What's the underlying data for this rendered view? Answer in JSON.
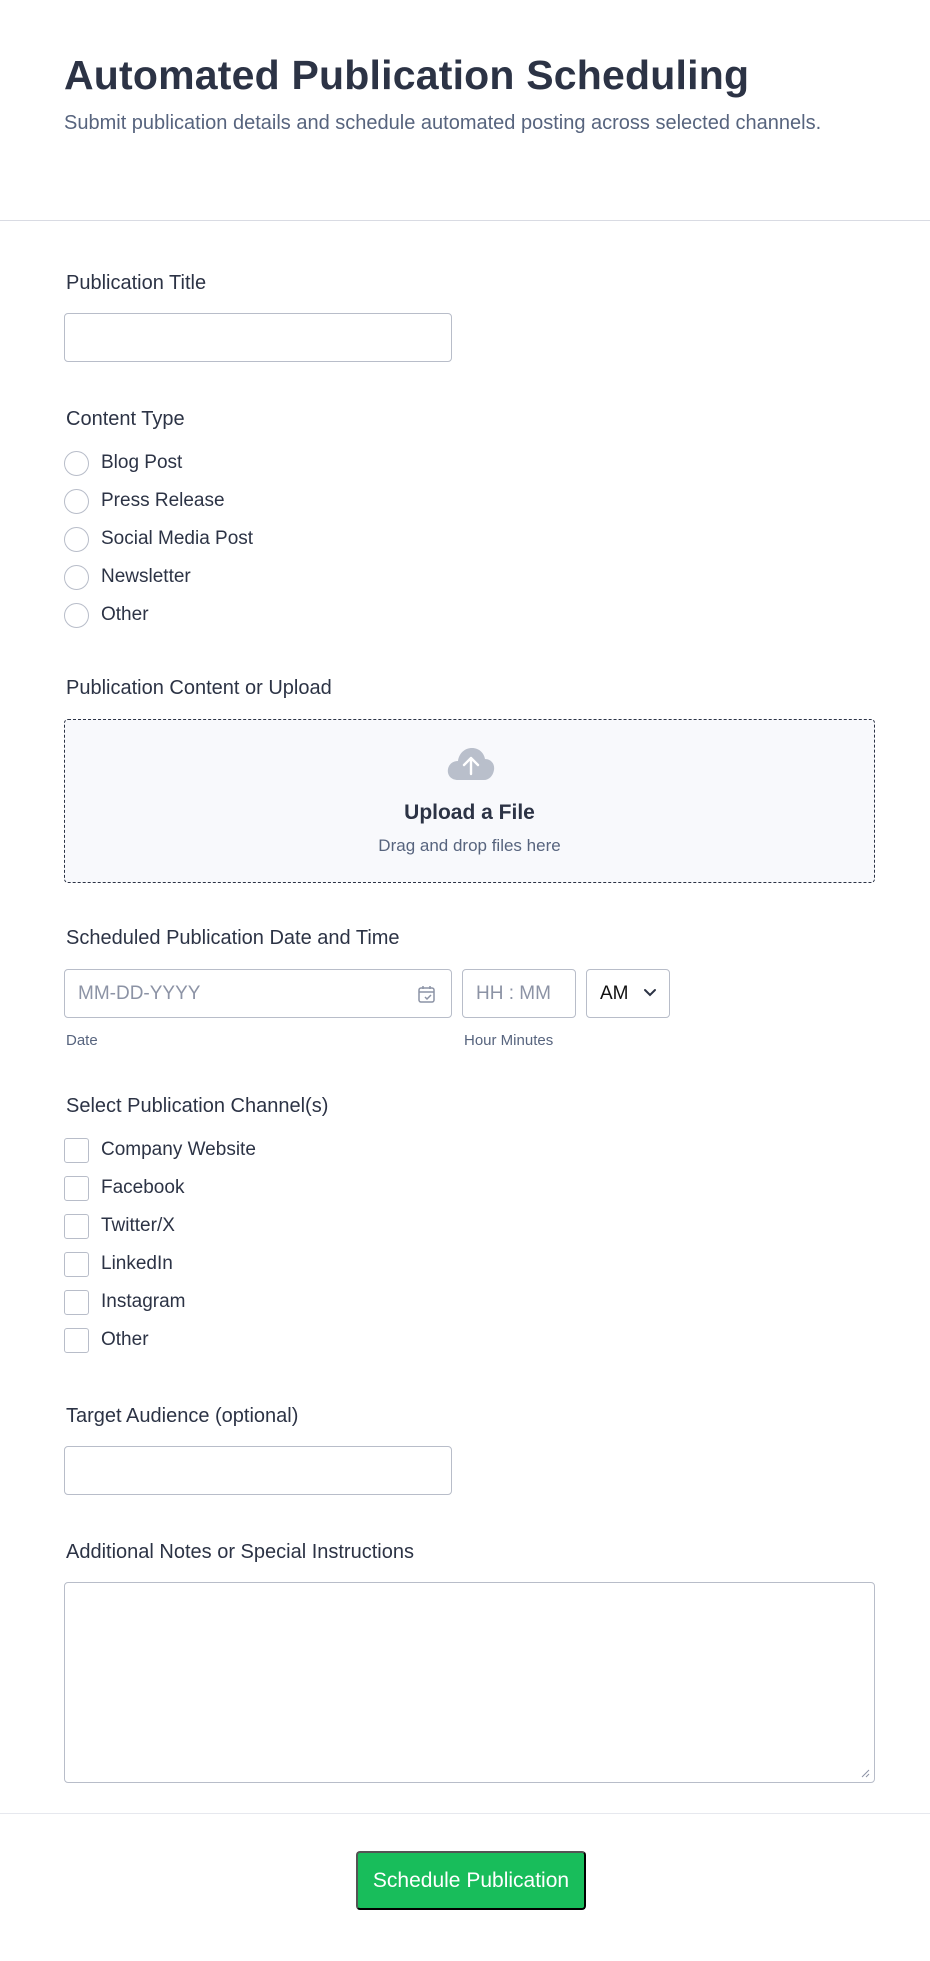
{
  "header": {
    "title": "Automated Publication Scheduling",
    "subtitle": "Submit publication details and schedule automated posting across selected channels."
  },
  "publication_title": {
    "label": "Publication Title",
    "value": "",
    "placeholder": ""
  },
  "content_type": {
    "label": "Content Type",
    "options": [
      "Blog Post",
      "Press Release",
      "Social Media Post",
      "Newsletter",
      "Other"
    ],
    "selected": null
  },
  "upload": {
    "label": "Publication Content or Upload",
    "title": "Upload a File",
    "subtitle": "Drag and drop files here",
    "icon": "cloud-upload-icon"
  },
  "schedule": {
    "label": "Scheduled Publication Date and Time",
    "date_placeholder": "MM-DD-YYYY",
    "date_sublabel": "Date",
    "time_placeholder": "HH : MM",
    "time_sublabel": "Hour Minutes",
    "ampm_value": "AM"
  },
  "channels": {
    "label": "Select Publication Channel(s)",
    "options": [
      "Company Website",
      "Facebook",
      "Twitter/X",
      "LinkedIn",
      "Instagram",
      "Other"
    ],
    "checked": []
  },
  "audience": {
    "label": "Target Audience (optional)",
    "value": ""
  },
  "notes": {
    "label": "Additional Notes or Special Instructions",
    "value": ""
  },
  "submit_label": "Schedule Publication",
  "colors": {
    "accent": "#18bd5b",
    "text": "#2c3345",
    "muted": "#57647e",
    "border": "#b8bdc9"
  }
}
